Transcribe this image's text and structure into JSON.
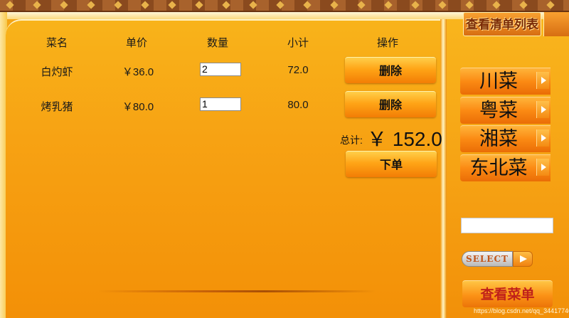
{
  "table": {
    "headers": [
      "菜名",
      "单价",
      "数量",
      "小计",
      "操作"
    ],
    "rows": [
      {
        "name": "白灼虾",
        "price": "￥36.0",
        "quantity": "2",
        "subtotal": "72.0",
        "action": "删除"
      },
      {
        "name": "烤乳猪",
        "price": "￥80.0",
        "quantity": "1",
        "subtotal": "80.0",
        "action": "删除"
      }
    ]
  },
  "total": {
    "label": "总计:",
    "value": "￥ 152.0"
  },
  "order_button": "下单",
  "view_list_button": "查看清单列表",
  "categories": [
    {
      "label": "川菜",
      "icon": "right-arrow-icon"
    },
    {
      "label": "粤菜",
      "icon": "right-arrow-icon"
    },
    {
      "label": "湘菜",
      "icon": "right-arrow-icon"
    },
    {
      "label": "东北菜",
      "icon": "right-arrow-icon"
    }
  ],
  "search": {
    "value": ""
  },
  "select_button": "SELECT",
  "view_menu_button": "查看菜单",
  "watermark": "https://blog.csdn.net/qq_34417740",
  "colors": {
    "accent": "#f7a213",
    "button": "#fb8a13",
    "menu_text": "#c0211a"
  }
}
